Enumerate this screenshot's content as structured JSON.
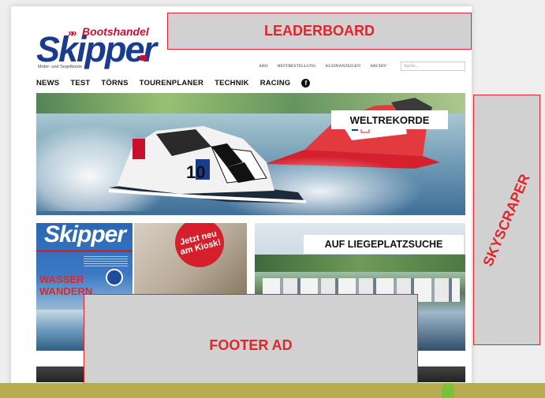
{
  "logo": {
    "brand_top": "Bootshandel",
    "brand_main": "Skipper",
    "tagline": "Motor- und Segelboote"
  },
  "ads": {
    "leaderboard": "LEADERBOARD",
    "skyscraper": "SKYSCRAPER",
    "footer": "FOOTER AD"
  },
  "utility_nav": [
    "ABO",
    "HEFTBESTELLUNG",
    "KLEINANZEIGEN",
    "ARCHIV"
  ],
  "search": {
    "placeholder": "Suche..."
  },
  "main_nav": [
    "NEWS",
    "TEST",
    "TÖRNS",
    "TOURENPLANER",
    "TECHNIK",
    "RACING"
  ],
  "main_nav_icon": "facebook-icon",
  "hero": {
    "label": "WELTREKORDE"
  },
  "magazine": {
    "logo": "Skipper",
    "headline_1": "WASSER",
    "headline_2": "WANDERN"
  },
  "promo": {
    "badge": "Jetzt neu\nam Kiosk!"
  },
  "marina": {
    "label": "AUF LIEGEPLATZSUCHE"
  },
  "colors": {
    "ad_border": "#e0262b",
    "ad_fill": "#d1d1d1",
    "brand_blue": "#1a3c8f",
    "brand_red": "#c8102e"
  }
}
